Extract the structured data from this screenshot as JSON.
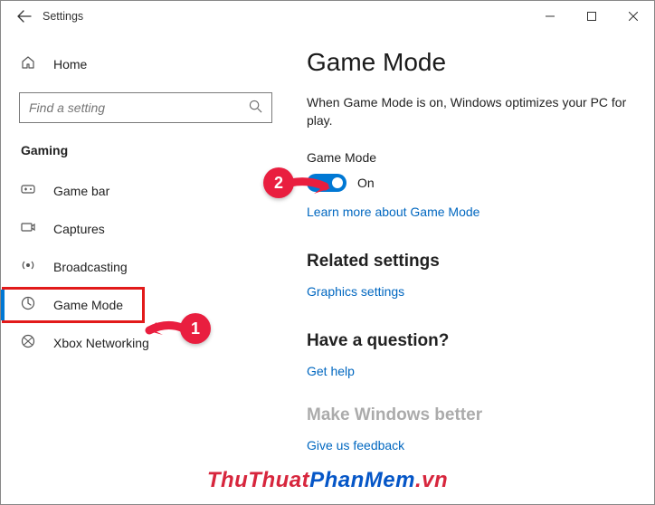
{
  "titlebar": {
    "title": "Settings"
  },
  "home_label": "Home",
  "search": {
    "placeholder": "Find a setting"
  },
  "category": "Gaming",
  "nav": {
    "items": [
      {
        "label": "Game bar"
      },
      {
        "label": "Captures"
      },
      {
        "label": "Broadcasting"
      },
      {
        "label": "Game Mode"
      },
      {
        "label": "Xbox Networking"
      }
    ]
  },
  "main": {
    "heading": "Game Mode",
    "description": "When Game Mode is on, Windows optimizes your PC for play.",
    "setting_label": "Game Mode",
    "toggle_state": "On",
    "learn_more": "Learn more about Game Mode",
    "related_heading": "Related settings",
    "related_link": "Graphics settings",
    "question_heading": "Have a question?",
    "get_help": "Get help",
    "better_heading": "Make Windows better",
    "feedback": "Give us feedback"
  },
  "callouts": {
    "one": "1",
    "two": "2"
  },
  "watermark": {
    "a": "ThuThuat",
    "b": "PhanMem",
    "c": ".vn"
  },
  "colors": {
    "accent": "#0078d4",
    "link": "#0067c0",
    "callout": "#e91e3f"
  }
}
